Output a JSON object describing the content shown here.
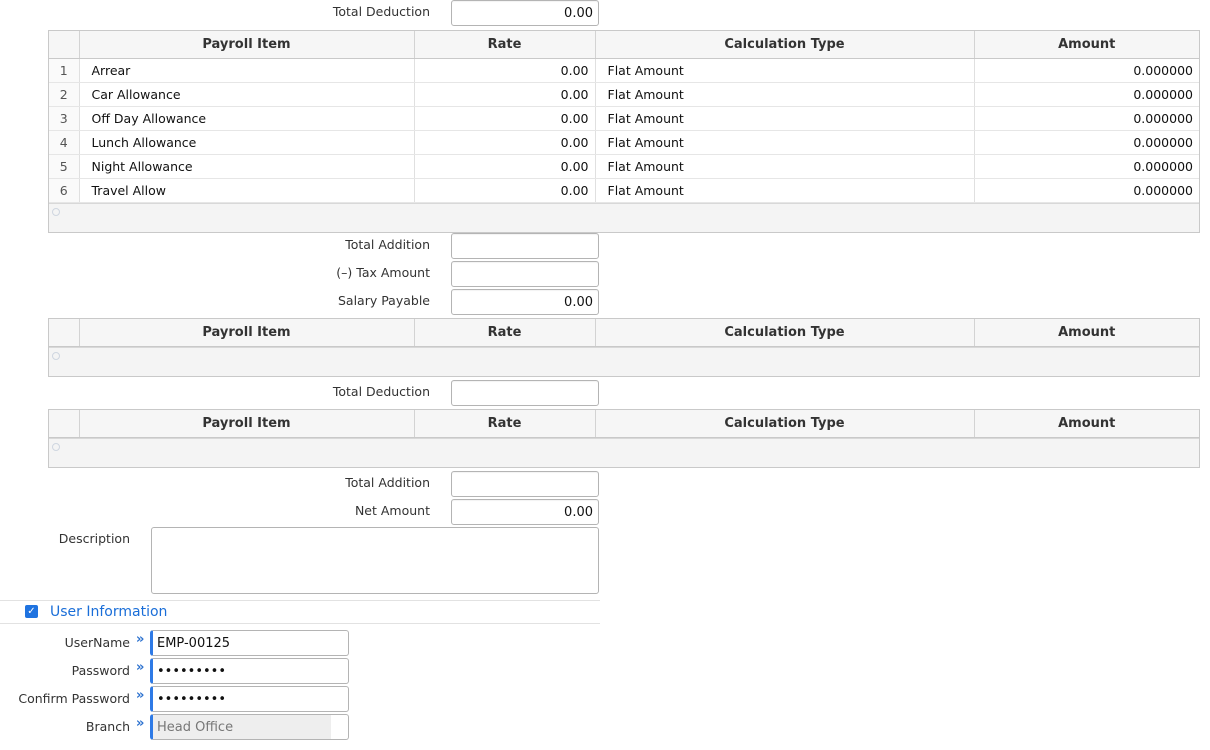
{
  "totals": {
    "total_deduction_top_label": "Total Deduction",
    "total_deduction_top_value": "0.00",
    "total_addition_1_label": "Total Addition",
    "total_addition_1_value": "",
    "tax_amount_label": "(–) Tax Amount",
    "tax_amount_value": "",
    "salary_payable_label": "Salary Payable",
    "salary_payable_value": "0.00",
    "total_deduction_2_label": "Total Deduction",
    "total_deduction_2_value": "",
    "total_addition_2_label": "Total Addition",
    "total_addition_2_value": "",
    "net_amount_label": "Net Amount",
    "net_amount_value": "0.00"
  },
  "columns": [
    "Payroll Item",
    "Rate",
    "Calculation Type",
    "Amount"
  ],
  "addition_grid": {
    "rows": [
      {
        "no": "1",
        "item": "Arrear",
        "rate": "0.00",
        "calc": "Flat Amount",
        "amount": "0.000000"
      },
      {
        "no": "2",
        "item": "Car Allowance",
        "rate": "0.00",
        "calc": "Flat Amount",
        "amount": "0.000000"
      },
      {
        "no": "3",
        "item": "Off Day Allowance",
        "rate": "0.00",
        "calc": "Flat Amount",
        "amount": "0.000000"
      },
      {
        "no": "4",
        "item": "Lunch Allowance",
        "rate": "0.00",
        "calc": "Flat Amount",
        "amount": "0.000000"
      },
      {
        "no": "5",
        "item": "Night Allowance",
        "rate": "0.00",
        "calc": "Flat Amount",
        "amount": "0.000000"
      },
      {
        "no": "6",
        "item": "Travel Allow",
        "rate": "0.00",
        "calc": "Flat Amount",
        "amount": "0.000000"
      }
    ]
  },
  "description": {
    "label": "Description",
    "value": ""
  },
  "user_info": {
    "section_title": "User Information",
    "checked": true,
    "username_label": "UserName",
    "username_value": "EMP-00125",
    "password_label": "Password",
    "password_value": "•••••••••",
    "confirm_label": "Confirm Password",
    "confirm_value": "•••••••••",
    "branch_label": "Branch",
    "branch_value": "Head Office",
    "required_marker": "»"
  },
  "colors": {
    "accent": "#1a6ed8",
    "required_border": "#2e7ae6"
  }
}
